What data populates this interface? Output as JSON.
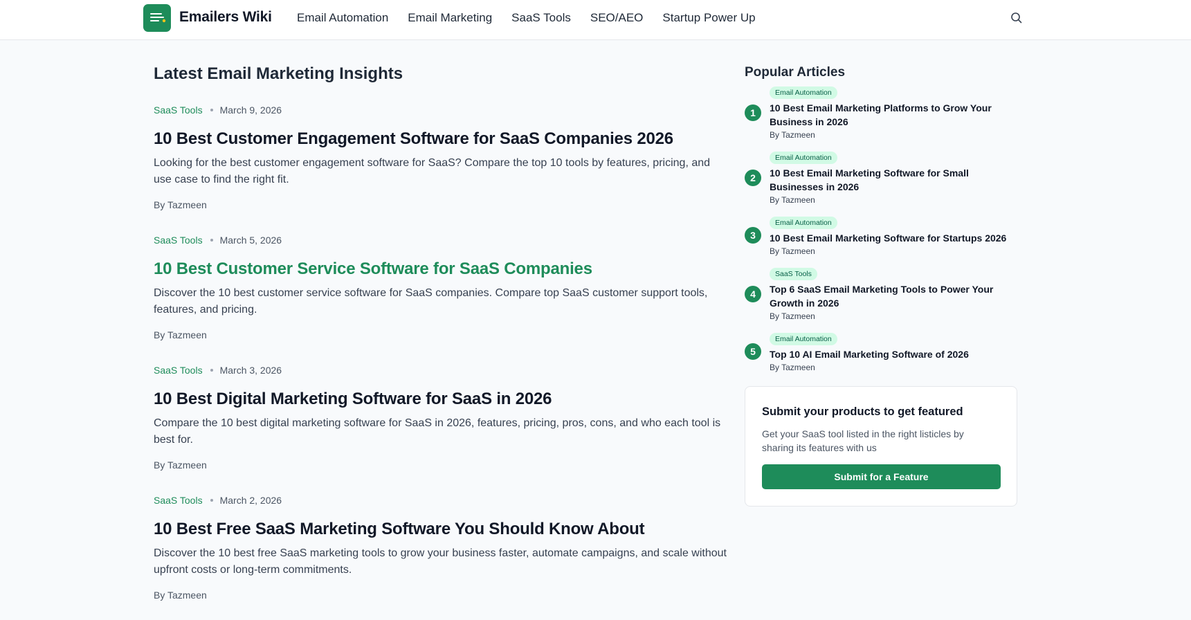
{
  "header": {
    "brand": "Emailers Wiki",
    "nav": [
      "Email Automation",
      "Email Marketing",
      "SaaS Tools",
      "SEO/AEO",
      "Startup Power Up"
    ],
    "search_icon": "search-icon",
    "accent": "#1e8c5a"
  },
  "main": {
    "title": "Latest Email Marketing Insights",
    "articles": [
      {
        "category": "SaaS Tools",
        "date": "March 9, 2026",
        "title": "10 Best Customer Engagement Software for SaaS Companies 2026",
        "excerpt": " Looking for the best customer engagement software for SaaS? Compare the top 10 tools by features, pricing, and use case to find the right fit.",
        "author": "By Tazmeen"
      },
      {
        "category": "SaaS Tools",
        "date": "March 5, 2026",
        "title": "10 Best Customer Service Software for SaaS Companies",
        "excerpt": "Discover the 10 best customer service software for SaaS companies. Compare top SaaS customer support tools, features, and pricing.",
        "author": "By Tazmeen"
      },
      {
        "category": "SaaS Tools",
        "date": "March 3, 2026",
        "title": "10 Best Digital Marketing Software for SaaS in 2026",
        "excerpt": "Compare the 10 best digital marketing software for SaaS in 2026, features, pricing, pros, cons, and who each tool is best for.",
        "author": "By Tazmeen"
      },
      {
        "category": "SaaS Tools",
        "date": "March 2, 2026",
        "title": "10 Best Free SaaS Marketing Software You Should Know About",
        "excerpt": "Discover the 10 best free SaaS marketing tools to grow your business faster, automate campaigns, and scale without upfront costs or long-term commitments.",
        "author": "By Tazmeen"
      }
    ]
  },
  "sidebar": {
    "title": "Popular Articles",
    "items": [
      {
        "num": "1",
        "tag": "Email Automation",
        "title": "10 Best Email Marketing Platforms to Grow Your Business in 2026",
        "author": "By Tazmeen"
      },
      {
        "num": "2",
        "tag": "Email Automation",
        "title": "10 Best Email Marketing Software for Small Businesses in 2026",
        "author": "By Tazmeen"
      },
      {
        "num": "3",
        "tag": "Email Automation",
        "title": "10 Best Email Marketing Software for Startups 2026",
        "author": "By Tazmeen"
      },
      {
        "num": "4",
        "tag": "SaaS Tools",
        "title": "Top 6 SaaS Email Marketing Tools to Power Your Growth in 2026",
        "author": "By Tazmeen"
      },
      {
        "num": "5",
        "tag": "Email Automation",
        "title": "Top 10 AI Email Marketing Software of 2026",
        "author": "By Tazmeen"
      }
    ],
    "feature": {
      "title": "Submit your products to get featured",
      "text": "Get your SaaS tool listed in the right listicles by sharing its features with us",
      "button": "Submit for a Feature"
    }
  }
}
